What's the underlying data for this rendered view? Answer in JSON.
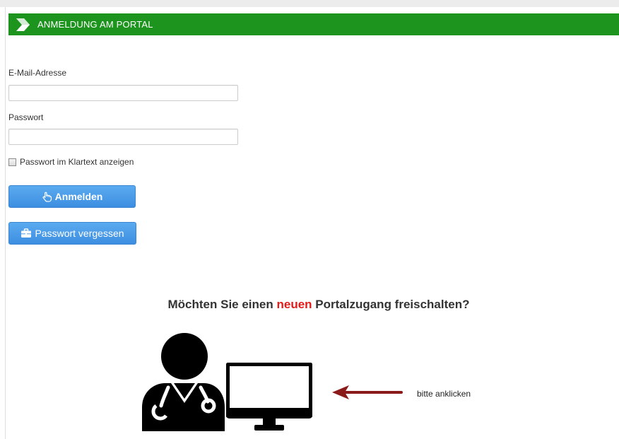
{
  "header": {
    "title": "ANMELDUNG AM PORTAL",
    "bar_color": "#1d941d"
  },
  "form": {
    "email_label": "E-Mail-Adresse",
    "email_value": "",
    "password_label": "Passwort",
    "password_value": "",
    "show_password_label": "Passwort im Klartext anzeigen",
    "show_password_checked": false
  },
  "buttons": {
    "login_label": "Anmelden",
    "login_icon": "hand-pointer-icon",
    "forgot_label": "Passwort vergessen",
    "forgot_icon": "briefcase-icon",
    "color": "#4a9de8"
  },
  "promo": {
    "question_before": "Möchten Sie einen",
    "question_highlight": "neuen",
    "question_after": "Portalzugang freischalten?",
    "highlight_color": "#e21b1b",
    "hint_text": "bitte anklicken",
    "arrow_color": "#8b1a1a",
    "icons": [
      "doctor-icon",
      "monitor-icon",
      "arrow-left-icon"
    ]
  }
}
